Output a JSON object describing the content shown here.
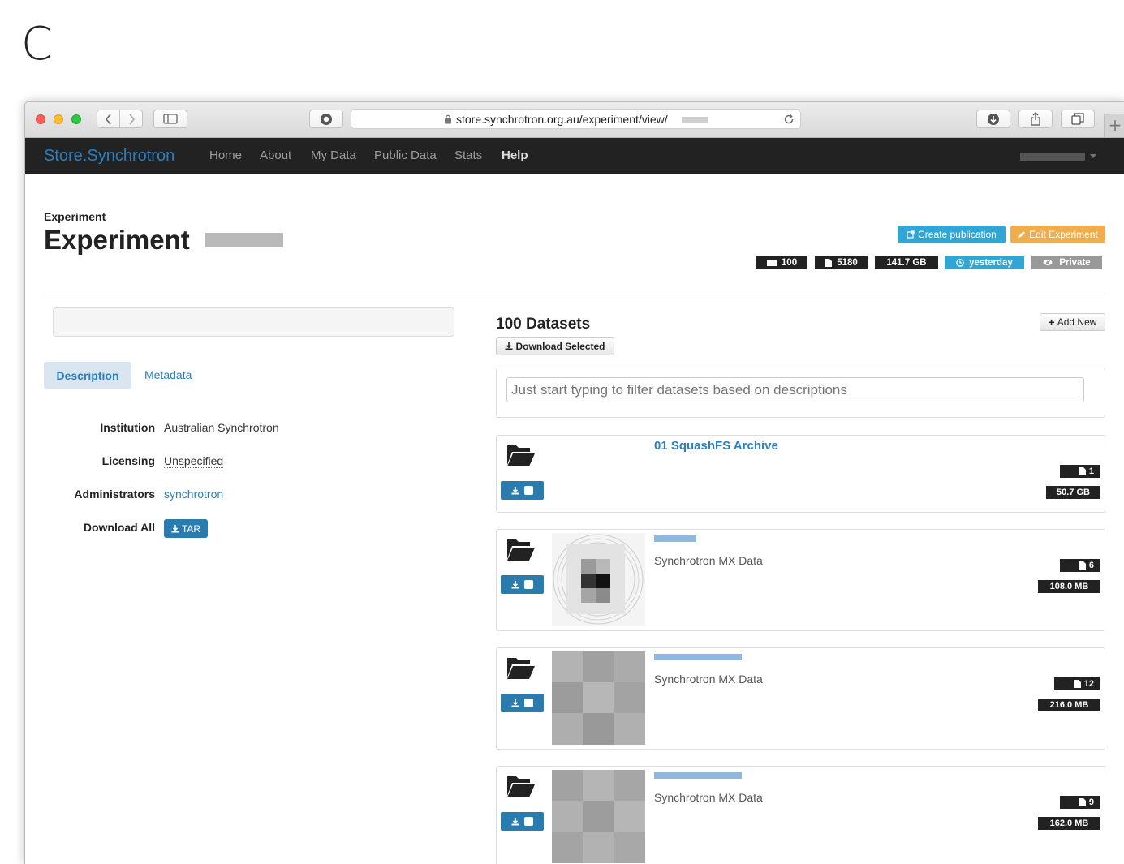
{
  "panel_label": "C",
  "browser": {
    "url": "store.synchrotron.org.au/experiment/view/",
    "new_tab": "+"
  },
  "navbar": {
    "brand": "Store.Synchrotron",
    "links": [
      "Home",
      "About",
      "My Data",
      "Public Data",
      "Stats",
      "Help"
    ]
  },
  "experiment": {
    "breadcrumb": "Experiment",
    "title": "Experiment",
    "create_publication": "Create publication",
    "edit_experiment": "Edit Experiment",
    "stats": {
      "datasets": "100",
      "files": "5180",
      "size": "141.7 GB",
      "updated": "yesterday",
      "visibility": "Private"
    }
  },
  "left_panel": {
    "tabs": [
      "Description",
      "Metadata"
    ],
    "fields": [
      {
        "label": "Institution",
        "value": "Australian Synchrotron"
      },
      {
        "label": "Licensing",
        "value": "Unspecified"
      },
      {
        "label": "Administrators",
        "value": "synchrotron"
      },
      {
        "label": "Download All",
        "value": "TAR"
      }
    ]
  },
  "datasets": {
    "heading": "100 Datasets",
    "download_selected": "Download Selected",
    "add_new": "Add New",
    "filter_placeholder": "Just start typing to filter datasets based on descriptions",
    "items": [
      {
        "name": "01 SquashFS Archive",
        "type": "",
        "files": "1",
        "size": "50.7 GB"
      },
      {
        "name": "",
        "type": "Synchrotron MX Data",
        "files": "6",
        "size": "108.0 MB"
      },
      {
        "name": "",
        "type": "Synchrotron MX Data",
        "files": "12",
        "size": "216.0 MB"
      },
      {
        "name": "",
        "type": "Synchrotron MX Data",
        "files": "9",
        "size": "162.0 MB"
      }
    ]
  },
  "colors": {
    "navbar": "#222222",
    "brand": "#2a7fc2",
    "info": "#31a6d4",
    "warning": "#f0ad4e",
    "dark_badge": "#222222",
    "grey_badge": "#999999"
  }
}
